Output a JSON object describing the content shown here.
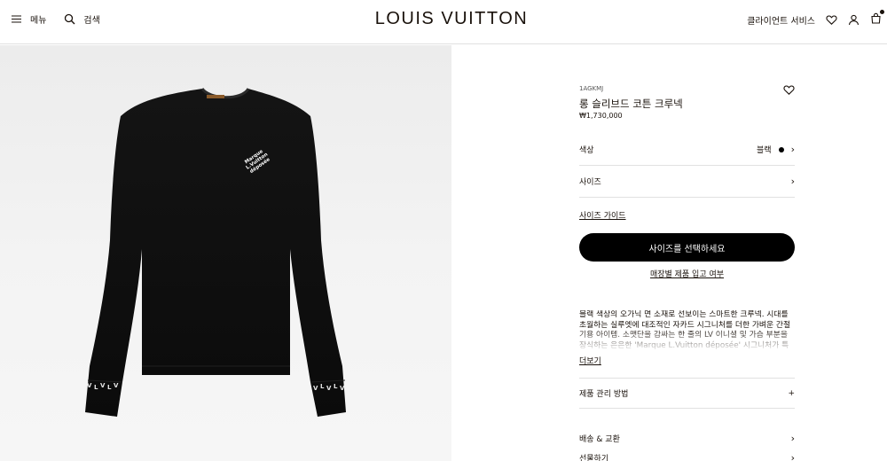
{
  "header": {
    "menu_label": "메뉴",
    "search_label": "검색",
    "logo": "LOUIS VUITTON",
    "client_service": "클라이언트 서비스"
  },
  "product": {
    "sku": "1AGKMJ",
    "name": "롱 슬리브드 코튼 크루넥",
    "price": "₩1,730,000",
    "color_label": "색상",
    "color_value": "블랙",
    "color_hex": "#000000",
    "size_label": "사이즈",
    "size_guide": "사이즈 가이드",
    "cta": "사이즈를 선택하세요",
    "in_store": "매장별 제품 입고 여부",
    "description": "블랙 색상의 오가닉 면 소재로 선보이는 스마트한 크루넥. 시대를 초월하는 실루엣에 대조적인 자카드 시그니처를 더한 가벼운 간절기용 아이템. 소맷단을 감싸는 한 줄의 LV 이니셜 및 가슴 부분을 장식하는 은은한 'Marque L.Vuitton déposée' 시그니처가 특징. 데일",
    "more": "더보기",
    "care": "제품 관리 방법",
    "shipping": "배송 & 교환",
    "gift": "선물하기"
  },
  "image": {
    "chest_print": [
      "Marque",
      "L.Vuitton",
      "déposée"
    ]
  }
}
